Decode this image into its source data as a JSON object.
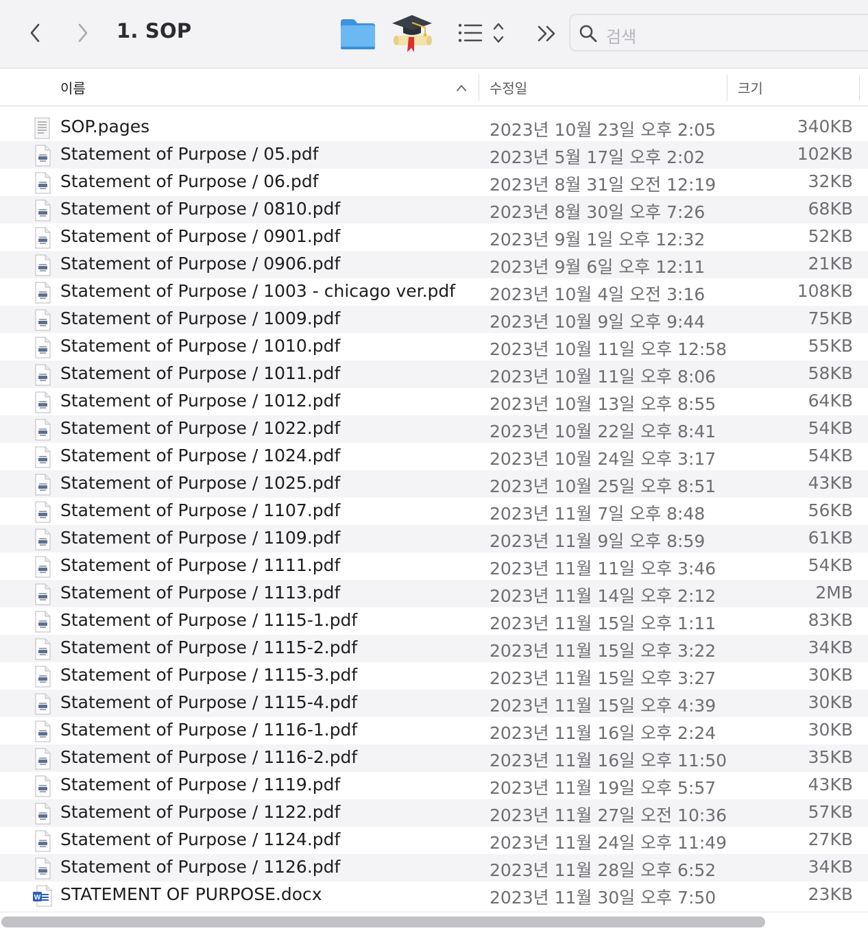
{
  "toolbar": {
    "title": "1. SOP",
    "search_placeholder": "검색",
    "icons": [
      "chevron-left-icon",
      "chevron-right-icon",
      "folder-icon",
      "graduation-cap-icon",
      "list-view-icon",
      "more-chevrons-icon",
      "search-icon"
    ]
  },
  "columns": {
    "name": "이름",
    "date": "수정일",
    "size": "크기",
    "sort": "ascending"
  },
  "files": [
    {
      "name": "SOP.pages",
      "date": "2023년 10월 23일 오후 2:05",
      "size": "340KB",
      "type": "pages"
    },
    {
      "name": "Statement of Purpose / 05.pdf",
      "date": "2023년 5월 17일 오후 2:02",
      "size": "102KB",
      "type": "pdf"
    },
    {
      "name": "Statement of Purpose / 06.pdf",
      "date": "2023년 8월 31일 오전 12:19",
      "size": "32KB",
      "type": "pdf"
    },
    {
      "name": "Statement of Purpose / 0810.pdf",
      "date": "2023년 8월 30일 오후 7:26",
      "size": "68KB",
      "type": "pdf"
    },
    {
      "name": "Statement of Purpose / 0901.pdf",
      "date": "2023년 9월 1일 오후 12:32",
      "size": "52KB",
      "type": "pdf"
    },
    {
      "name": "Statement of Purpose / 0906.pdf",
      "date": "2023년 9월 6일 오후 12:11",
      "size": "21KB",
      "type": "pdf"
    },
    {
      "name": "Statement of Purpose / 1003 - chicago ver.pdf",
      "date": "2023년 10월 4일 오전 3:16",
      "size": "108KB",
      "type": "pdf"
    },
    {
      "name": "Statement of Purpose / 1009.pdf",
      "date": "2023년 10월 9일 오후 9:44",
      "size": "75KB",
      "type": "pdf"
    },
    {
      "name": "Statement of Purpose / 1010.pdf",
      "date": "2023년 10월 11일 오후 12:58",
      "size": "55KB",
      "type": "pdf"
    },
    {
      "name": "Statement of Purpose / 1011.pdf",
      "date": "2023년 10월 11일 오후 8:06",
      "size": "58KB",
      "type": "pdf"
    },
    {
      "name": "Statement of Purpose / 1012.pdf",
      "date": "2023년 10월 13일 오후 8:55",
      "size": "64KB",
      "type": "pdf"
    },
    {
      "name": "Statement of Purpose / 1022.pdf",
      "date": "2023년 10월 22일 오후 8:41",
      "size": "54KB",
      "type": "pdf"
    },
    {
      "name": "Statement of Purpose / 1024.pdf",
      "date": "2023년 10월 24일 오후 3:17",
      "size": "54KB",
      "type": "pdf"
    },
    {
      "name": "Statement of Purpose / 1025.pdf",
      "date": "2023년 10월 25일 오후 8:51",
      "size": "43KB",
      "type": "pdf"
    },
    {
      "name": "Statement of Purpose / 1107.pdf",
      "date": "2023년 11월 7일 오후 8:48",
      "size": "56KB",
      "type": "pdf"
    },
    {
      "name": "Statement of Purpose / 1109.pdf",
      "date": "2023년 11월 9일 오후 8:59",
      "size": "61KB",
      "type": "pdf"
    },
    {
      "name": "Statement of Purpose / 1111.pdf",
      "date": "2023년 11월 11일 오후 3:46",
      "size": "54KB",
      "type": "pdf"
    },
    {
      "name": "Statement of Purpose / 1113.pdf",
      "date": "2023년 11월 14일 오후 2:12",
      "size": "2MB",
      "type": "pdf"
    },
    {
      "name": "Statement of Purpose / 1115-1.pdf",
      "date": "2023년 11월 15일 오후 1:11",
      "size": "83KB",
      "type": "pdf"
    },
    {
      "name": "Statement of Purpose / 1115-2.pdf",
      "date": "2023년 11월 15일 오후 3:22",
      "size": "34KB",
      "type": "pdf"
    },
    {
      "name": "Statement of Purpose / 1115-3.pdf",
      "date": "2023년 11월 15일 오후 3:27",
      "size": "30KB",
      "type": "pdf"
    },
    {
      "name": "Statement of Purpose / 1115-4.pdf",
      "date": "2023년 11월 15일 오후 4:39",
      "size": "30KB",
      "type": "pdf"
    },
    {
      "name": "Statement of Purpose / 1116-1.pdf",
      "date": "2023년 11월 16일 오후 2:24",
      "size": "30KB",
      "type": "pdf"
    },
    {
      "name": "Statement of Purpose / 1116-2.pdf",
      "date": "2023년 11월 16일 오후 11:50",
      "size": "35KB",
      "type": "pdf"
    },
    {
      "name": "Statement of Purpose / 1119.pdf",
      "date": "2023년 11월 19일 오후 5:57",
      "size": "43KB",
      "type": "pdf"
    },
    {
      "name": "Statement of Purpose / 1122.pdf",
      "date": "2023년 11월 27일 오전 10:36",
      "size": "57KB",
      "type": "pdf"
    },
    {
      "name": "Statement of Purpose / 1124.pdf",
      "date": "2023년 11월 24일 오후 11:49",
      "size": "27KB",
      "type": "pdf"
    },
    {
      "name": "Statement of Purpose / 1126.pdf",
      "date": "2023년 11월 28일 오후 6:52",
      "size": "34KB",
      "type": "pdf"
    },
    {
      "name": "STATEMENT OF PURPOSE.docx",
      "date": "2023년 11월 30일 오후 7:50",
      "size": "23KB",
      "type": "docx"
    }
  ],
  "colors": {
    "toolbar_bg": "#f3f2f5",
    "row_alt_bg": "#f4f4f6",
    "folder_blue": "#4aa3ec",
    "scroll_thumb": "#c2c2c6"
  }
}
